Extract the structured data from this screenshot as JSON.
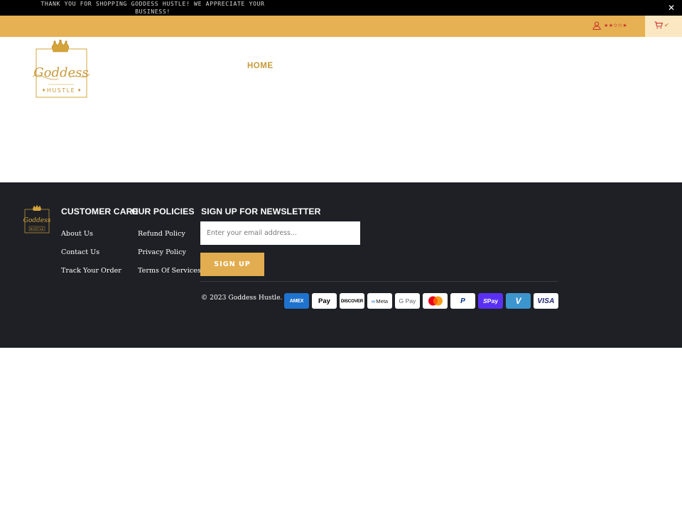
{
  "announcement": {
    "text": "THANK YOU FOR SHOPPING GODDESS HUSTLE! WE APPRECIATE YOUR BUSINESS!",
    "close_icon": "close-icon"
  },
  "utility_bar": {
    "account_icon": "user-icon",
    "account_stars": "★★✩✩★",
    "cart_icon": "cart-icon",
    "cart_check": "✔",
    "background": "#e5b152"
  },
  "header": {
    "logo": {
      "script": "Goddess",
      "word": "HUSTLE"
    },
    "nav": {
      "home": "HOME"
    }
  },
  "footer": {
    "logo": {
      "script": "Goddess",
      "word": "HUSTLE"
    },
    "customer_care": {
      "title": "CUSTOMER CARE",
      "links": [
        "About Us",
        "Contact Us",
        "Track Your Order"
      ]
    },
    "policies": {
      "title": "OUR POLICIES",
      "links": [
        "Refund Policy",
        "Privacy Policy",
        "Terms Of Services"
      ]
    },
    "newsletter": {
      "title": "SIGN UP FOR NEWSLETTER",
      "placeholder": "Enter your email address...",
      "button": "SIGN UP"
    },
    "copyright": "© 2023 Goddess Hustle.",
    "payments": [
      {
        "name": "American Express",
        "label": "AMEX"
      },
      {
        "name": "Apple Pay",
        "label": "Pay"
      },
      {
        "name": "Discover",
        "label": "DISCOVER"
      },
      {
        "name": "Meta Pay",
        "label": "Meta"
      },
      {
        "name": "Google Pay",
        "label": "G Pay"
      },
      {
        "name": "Mastercard",
        "label": ""
      },
      {
        "name": "PayPal",
        "label": "P"
      },
      {
        "name": "Shop Pay",
        "label": "Pay"
      },
      {
        "name": "Venmo",
        "label": "V"
      },
      {
        "name": "Visa",
        "label": "VISA"
      }
    ],
    "colors": {
      "background": "#1e2025",
      "accent": "#e2ad50"
    }
  }
}
